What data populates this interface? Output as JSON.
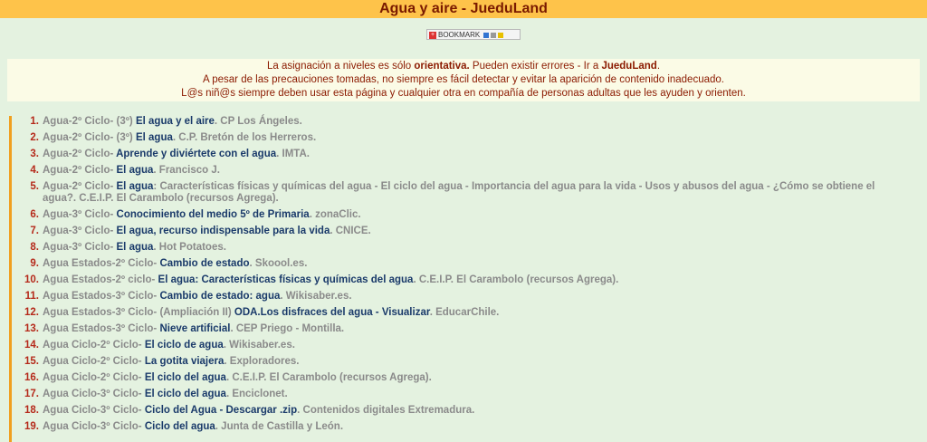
{
  "title": "Agua y aire - JueduLand",
  "bookmark": {
    "label": "BOOKMARK"
  },
  "notice": {
    "l1_pre": "La asignación a niveles es sólo ",
    "l1_bold": "orientativa.",
    "l1_mid": " Pueden existir errores -  Ir a ",
    "l1_link": "JueduLand",
    "l1_end": ".",
    "l2": "A pesar de las precauciones tomadas, no siempre es fácil detectar y evitar la aparición de contenido inadecuado.",
    "l3": "L@s niñ@s siempre deben usar esta página y cualquier otra en compañía de personas adultas que les ayuden y orienten."
  },
  "items": [
    {
      "num": "1.",
      "lvl": "Agua-2º Ciclo- (3º) ",
      "lnk": "El agua y el aire",
      "src": ". CP Los Ángeles."
    },
    {
      "num": "2.",
      "lvl": "Agua-2º Ciclo- (3º) ",
      "lnk": "El agua",
      "src": ". C.P. Bretón de los Herreros."
    },
    {
      "num": "3.",
      "lvl": "Agua-2º Ciclo- ",
      "lnk": "Aprende y diviértete con el agua",
      "src": ". IMTA."
    },
    {
      "num": "4.",
      "lvl": "Agua-2º Ciclo- ",
      "lnk": "El agua",
      "src": ". Francisco J."
    },
    {
      "num": "5.",
      "lvl": "Agua-2º Ciclo- ",
      "lnk": "El agua",
      "src": ": Características físicas y químicas del agua - El ciclo del agua - Importancia del agua para la vida - Usos y abusos del agua - ¿Cómo se obtiene el agua?. C.E.I.P. El Carambolo (recursos Agrega)."
    },
    {
      "num": "6.",
      "lvl": "Agua-3º Ciclo- ",
      "lnk": "Conocimiento del medio 5º de Primaria",
      "src": ". zonaClic."
    },
    {
      "num": "7.",
      "lvl": "Agua-3º Ciclo- ",
      "lnk": "El agua, recurso indispensable para la vida",
      "src": ". CNICE."
    },
    {
      "num": "8.",
      "lvl": "Agua-3º Ciclo- ",
      "lnk": "El agua",
      "src": ". Hot Potatoes."
    },
    {
      "num": "9.",
      "lvl": "Agua Estados-2º Ciclo- ",
      "lnk": "Cambio de estado",
      "src": ". Skoool.es."
    },
    {
      "num": "10.",
      "lvl": "Agua Estados-2º ciclo- ",
      "lnk": "El agua: Características físicas y químicas del agua",
      "src": ". C.E.I.P. El Carambolo (recursos Agrega)."
    },
    {
      "num": "11.",
      "lvl": "Agua Estados-3º Ciclo- ",
      "lnk": "Cambio de estado: agua",
      "src": ". Wikisaber.es."
    },
    {
      "num": "12.",
      "lvl": "Agua Estados-3º Ciclo- (Ampliación II) ",
      "lnk": "ODA.Los disfraces del agua - Visualizar",
      "src": ". EducarChile."
    },
    {
      "num": "13.",
      "lvl": "Agua Estados-3º Ciclo- ",
      "lnk": "Nieve artificial",
      "src": ". CEP Priego - Montilla."
    },
    {
      "num": "14.",
      "lvl": "Agua Ciclo-2º Ciclo- ",
      "lnk": "El ciclo de agua",
      "src": ". Wikisaber.es."
    },
    {
      "num": "15.",
      "lvl": "Agua Ciclo-2º Ciclo- ",
      "lnk": "La gotita viajera",
      "src": ". Exploradores."
    },
    {
      "num": "16.",
      "lvl": "Agua Ciclo-2º Ciclo- ",
      "lnk": "El ciclo del agua",
      "src": ". C.E.I.P. El Carambolo (recursos Agrega)."
    },
    {
      "num": "17.",
      "lvl": "Agua Ciclo-3º Ciclo- ",
      "lnk": "El ciclo del agua",
      "src": ". Enciclonet."
    },
    {
      "num": "18.",
      "lvl": "Agua Ciclo-3º Ciclo- ",
      "lnk": "Ciclo del Agua - Descargar .zip",
      "src": ". Contenidos digitales Extremadura."
    },
    {
      "num": "19.",
      "lvl": "Agua Ciclo-3º Ciclo- ",
      "lnk": "Ciclo del agua",
      "src": ". Junta de Castilla y León."
    }
  ]
}
